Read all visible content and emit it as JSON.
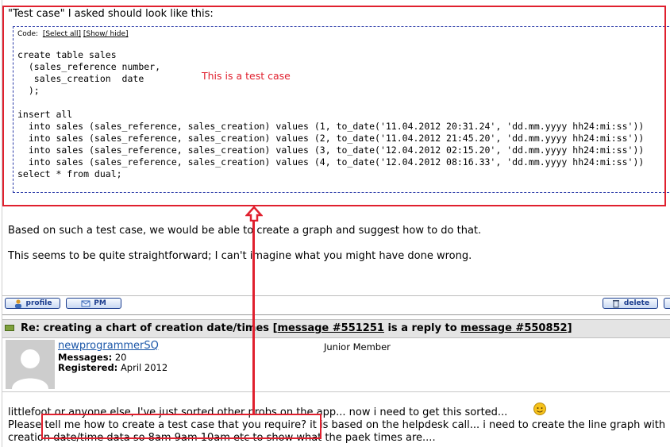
{
  "intro": "\"Test case\" I asked should look like this:",
  "code_header": {
    "prefix": "Code:",
    "select_all": "[Select all]",
    "show_hide": "[Show/ hide]"
  },
  "code_lines": [
    "create table sales",
    "  (sales_reference number,",
    "   sales_creation  date",
    "  );",
    "",
    "insert all",
    "  into sales (sales_reference, sales_creation) values (1, to_date('11.04.2012 20:31.24', 'dd.mm.yyyy hh24:mi:ss'))",
    "  into sales (sales_reference, sales_creation) values (2, to_date('11.04.2012 21:45.20', 'dd.mm.yyyy hh24:mi:ss'))",
    "  into sales (sales_reference, sales_creation) values (3, to_date('12.04.2012 02:15.20', 'dd.mm.yyyy hh24:mi:ss'))",
    "  into sales (sales_reference, sales_creation) values (4, to_date('12.04.2012 08:16.33', 'dd.mm.yyyy hh24:mi:ss'))",
    "select * from dual;"
  ],
  "annotation": "This is a test case",
  "para1": "Based on such a test case, we would be able to create a graph and suggest how to do that.",
  "para2": "This seems to be quite straightforward; I can't imagine what you might have done wrong.",
  "buttons": {
    "profile": "profile",
    "pm": "PM",
    "delete": "delete"
  },
  "message_header": {
    "title": "Re: creating a chart of creation date/times",
    "ref_open": "[",
    "message_link": "message #551251",
    "reply_text": " is a reply to ",
    "reply_link": "message #550852",
    "ref_close": "]"
  },
  "user": {
    "name": "newprogrammerSQ",
    "messages_label": "Messages:",
    "messages_value": "20",
    "registered_label": "Registered:",
    "registered_value": "April 2012",
    "rank": "Junior Member"
  },
  "body_lines": [
    "littlefoot or anyone else, I've just sorted other probs on the app... now i need to get this sorted...",
    "Please tell me how to create a test case that you require? it is based on the helpdesk call... i need to create the line graph with",
    "creation date/time data so 8am 9am 10am etc to show what the paek times are...."
  ],
  "colors": {
    "annotation_red": "#e0202e",
    "link_blue": "#1a56a8",
    "code_border": "#2a3aa8"
  }
}
